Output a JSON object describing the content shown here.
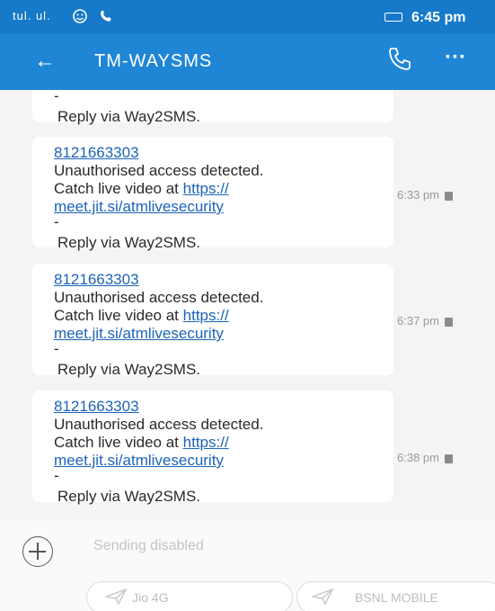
{
  "status_bar": {
    "signal_text": "tul. ul.",
    "time": "6:45 pm",
    "icons": [
      "signal-icon",
      "emoji-icon",
      "call-indicator-icon",
      "battery-icon"
    ]
  },
  "app_bar": {
    "back_icon": "←",
    "title": "TM-WAYSMS",
    "more_icon": "···"
  },
  "messages": [
    {
      "partial": true,
      "dash": "-",
      "reply": "Reply via Way2SMS."
    },
    {
      "sender": "8121663303",
      "text_line1": "Unauthorised access detected.",
      "text_line2": "Catch live video at ",
      "link_part1": "https://",
      "link_part2": "meet.jit.si/atmlivesecurity",
      "dash": "-",
      "reply": "Reply via Way2SMS.",
      "time": "6:33 pm"
    },
    {
      "sender": "8121663303",
      "text_line1": "Unauthorised access detected.",
      "text_line2": "Catch live video at ",
      "link_part1": "https://",
      "link_part2": "meet.jit.si/atmlivesecurity",
      "dash": "-",
      "reply": "Reply via Way2SMS.",
      "time": "6:37 pm"
    },
    {
      "sender": "8121663303",
      "text_line1": "Unauthorised access detected.",
      "text_line2": "Catch live video at ",
      "link_part1": "https://",
      "link_part2": "meet.jit.si/atmlivesecurity",
      "dash": "-",
      "reply": "Reply via Way2SMS.",
      "time": "6:38 pm"
    }
  ],
  "compose": {
    "placeholder": "Sending disabled",
    "sim_options": [
      "Jio 4G",
      "BSNL MOBILE"
    ]
  },
  "colors": {
    "app_bar": "#1f86d6",
    "status_bar": "#1679c9",
    "link": "#1b63b8"
  }
}
